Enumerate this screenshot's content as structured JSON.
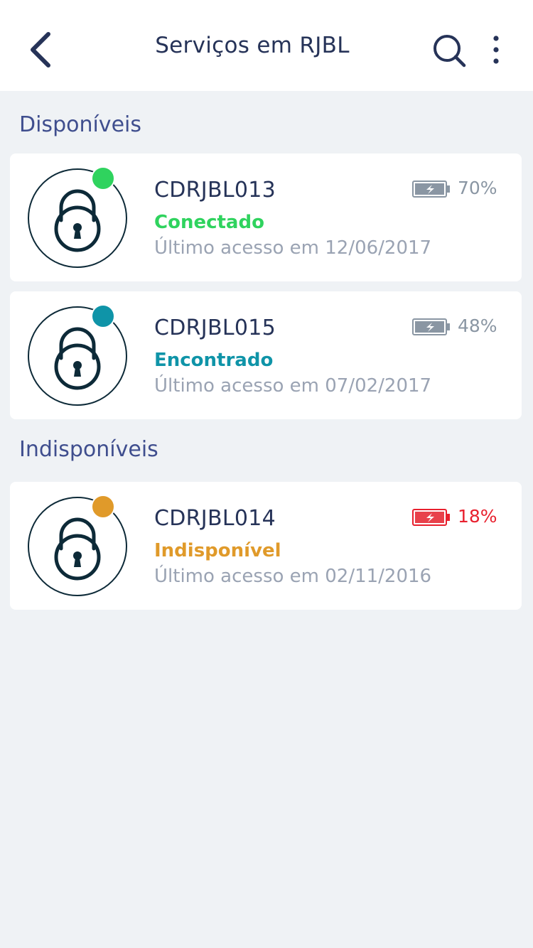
{
  "header": {
    "title": "Serviços em RJBL",
    "back_icon": "chevron-left-icon",
    "search_icon": "search-icon",
    "more_icon": "more-vertical-icon"
  },
  "sections": {
    "available": "Disponíveis",
    "unavailable": "Indisponíveis"
  },
  "devices": [
    {
      "name": "CDRJBL013",
      "status": "Conectado",
      "status_color": "#2fd35e",
      "last_access": "Último acesso em 12/06/2017",
      "battery": "70%",
      "battery_level": 0.7,
      "battery_color": "#8a96a3"
    },
    {
      "name": "CDRJBL015",
      "status": "Encontrado",
      "status_color": "#0f94a8",
      "last_access": "Último acesso em 07/02/2017",
      "battery": "48%",
      "battery_level": 0.48,
      "battery_color": "#8a96a3"
    },
    {
      "name": "CDRJBL014",
      "status": "Indisponível",
      "status_color": "#e09a2a",
      "last_access": "Último acesso em 02/11/2016",
      "battery": "18%",
      "battery_level": 0.18,
      "battery_color": "#e8202e"
    }
  ]
}
